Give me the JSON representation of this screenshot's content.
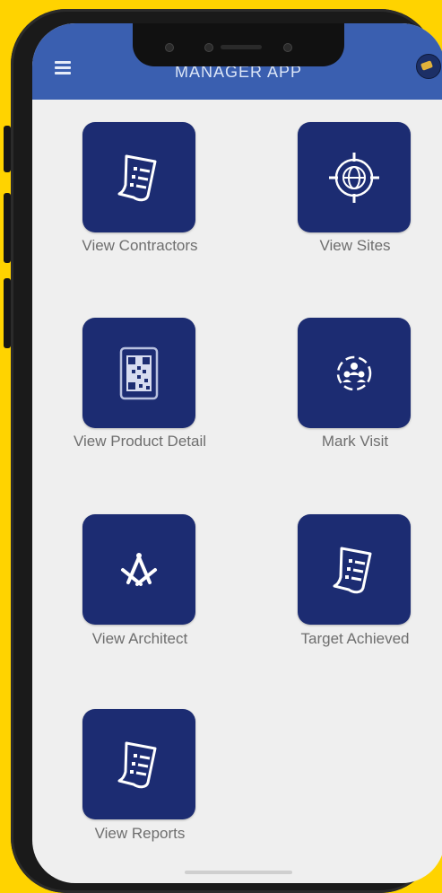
{
  "header": {
    "title": "MANAGER APP"
  },
  "tiles": [
    {
      "label": "View Contractors",
      "icon": "document-list-icon"
    },
    {
      "label": "View Sites",
      "icon": "globe-target-icon"
    },
    {
      "label": "View Product Detail",
      "icon": "qr-code-icon"
    },
    {
      "label": "Mark Visit",
      "icon": "group-visit-icon"
    },
    {
      "label": "View Architect",
      "icon": "compass-square-icon"
    },
    {
      "label": "Target Achieved",
      "icon": "document-list-icon"
    },
    {
      "label": "View Reports",
      "icon": "document-list-icon"
    }
  ],
  "colors": {
    "background": "#FFD300",
    "appbar": "#3a5fb0",
    "tile": "#1c2c72",
    "label": "#6e6e6e"
  }
}
